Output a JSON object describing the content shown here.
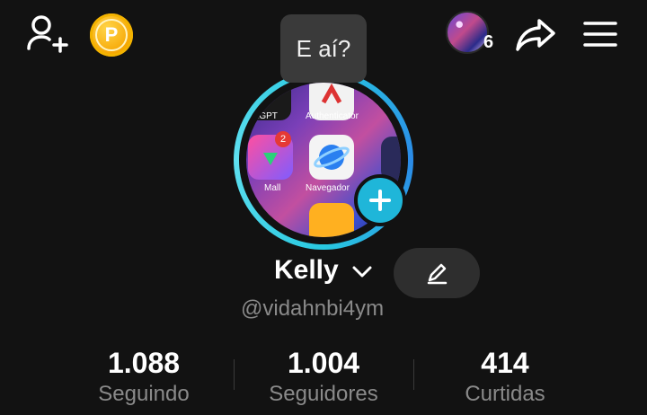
{
  "topbar": {
    "add_friend_icon": "person-add-icon",
    "coin_label": "P",
    "notification_count": "6",
    "share_icon": "share-arrow-icon",
    "menu_icon": "hamburger-menu-icon"
  },
  "tooltip": {
    "text": "E aí?"
  },
  "profile_picture": {
    "apps": [
      {
        "label": "atGPT"
      },
      {
        "label": "Authenticator"
      },
      {
        "label": "Mall",
        "badge": "2"
      },
      {
        "label": "Navegador"
      }
    ]
  },
  "profile": {
    "name": "Kelly",
    "handle": "@vidahnbi4ym"
  },
  "stats": [
    {
      "value": "1.088",
      "label": "Seguindo"
    },
    {
      "value": "1.004",
      "label": "Seguidores"
    },
    {
      "value": "414",
      "label": "Curtidas"
    }
  ],
  "colors": {
    "background": "#121212",
    "accent": "#1fb6d9",
    "coin": "#f6a400",
    "secondary_text": "#8a8a8a"
  }
}
